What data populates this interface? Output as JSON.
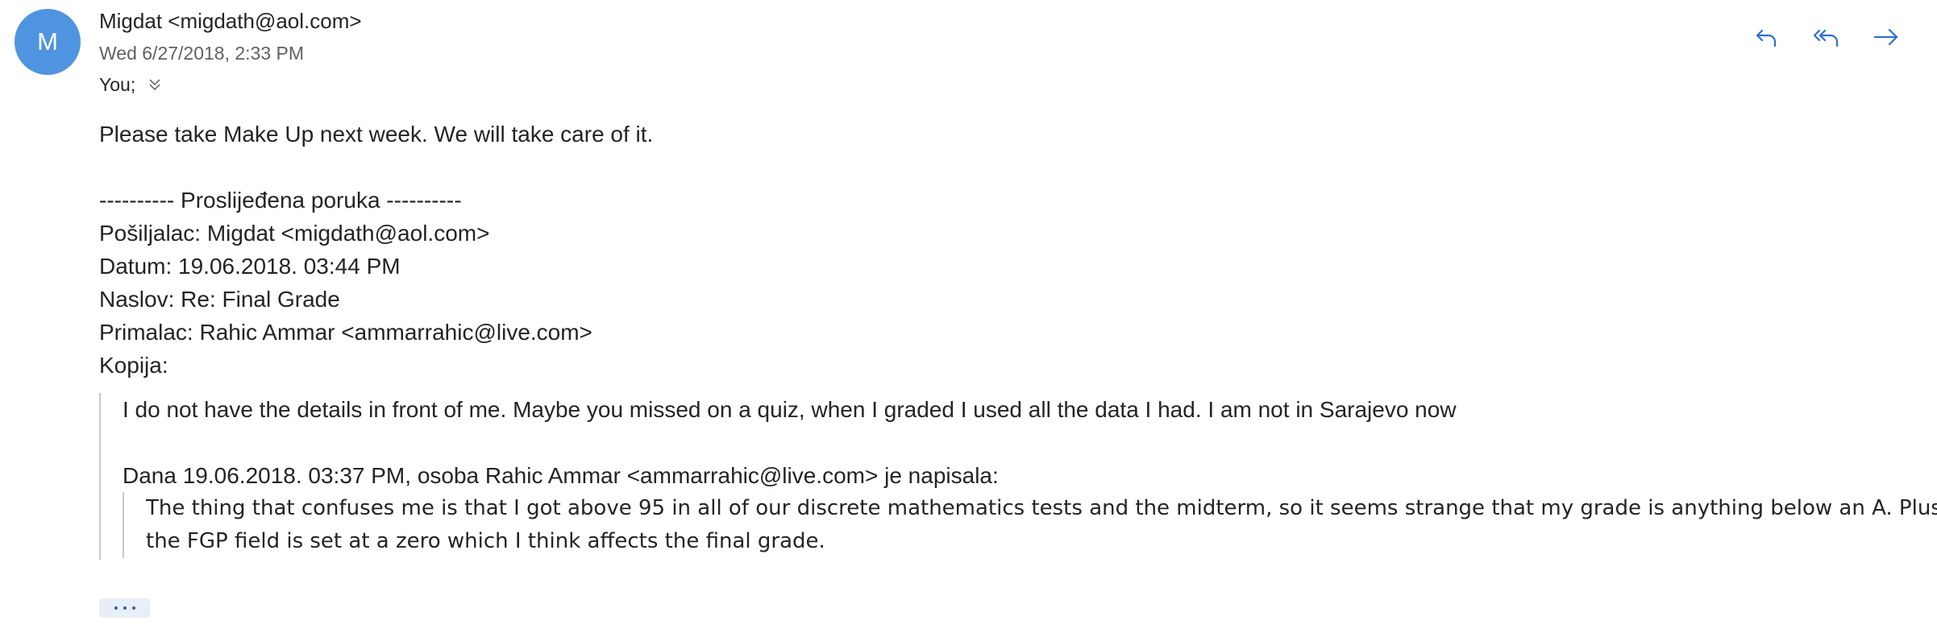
{
  "sender": {
    "avatar_initial": "M",
    "display": "Migdat <migdath@aol.com>"
  },
  "sent_date": "Wed 6/27/2018, 2:33 PM",
  "recipients": {
    "label": "You;"
  },
  "actions": {
    "reply_icon": "reply-icon",
    "reply_all_icon": "reply-all-icon",
    "forward_icon": "forward-icon"
  },
  "body": {
    "message": "Please take Make Up next week. We will take care of it.",
    "forward_header": "---------- Proslijeđena poruka ----------",
    "forward_from": "Pošiljalac: Migdat <migdath@aol.com>",
    "forward_date": "Datum: 19.06.2018. 03:44 PM",
    "forward_subject": "Naslov: Re: Final Grade",
    "forward_to": "Primalac: Rahic Ammar <ammarrahic@live.com>",
    "forward_cc": "Kopija:",
    "quoted_reply": "I do not have the details in front of me. Maybe you missed on a quiz, when I graded I used all the data I had. I am not in Sarajevo now",
    "attribution": "Dana 19.06.2018. 03:37 PM, osoba Rahic Ammar <ammarrahic@live.com> je napisala:",
    "original_line1": "The thing that confuses me is that I got above 95 in all of our discrete mathematics tests and the midterm, so it seems strange that my grade is anything below an A. Plus,",
    "original_line2": "the FGP field is set at a zero which I think affects the final grade."
  },
  "colors": {
    "avatar_bg": "#4f94e0",
    "accent": "#2b6fd6",
    "secondary_text": "#616161",
    "quote_border": "#c8c8c8"
  }
}
